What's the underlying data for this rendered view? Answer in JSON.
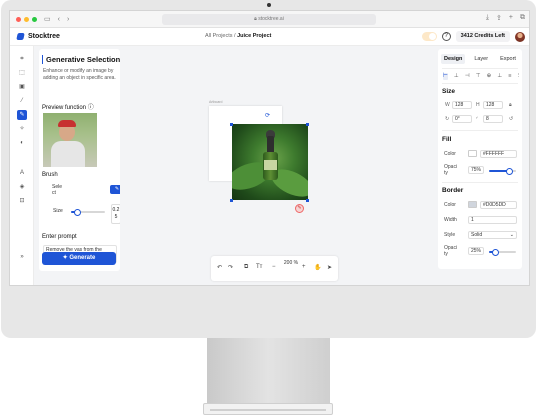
{
  "browser": {
    "url": "stocktree.ai"
  },
  "header": {
    "brand": "Stocktree",
    "breadcrumb_parent": "All Projects",
    "breadcrumb_sep": "/",
    "breadcrumb_current": "Juice Project",
    "help_glyph": "?",
    "credits": "3412 Credits Left"
  },
  "rail": {
    "tools": [
      "crop-icon",
      "select-icon",
      "image-icon",
      "wand-icon",
      "generative-selection-icon",
      "magic-edit-icon",
      "color-icon",
      "text-icon",
      "layers-icon",
      "upscale-icon"
    ],
    "expand": "»"
  },
  "left_panel": {
    "title": "Generative Selection",
    "description": "Enhance or modify an image by adding an object in specific area.",
    "preview_label": "Preview function",
    "brush_label": "Brush",
    "brush_select_label": "Select",
    "size_label": "Size",
    "size_value": "0.25",
    "size_fraction": 0.2,
    "prompt_label": "Enter prompt",
    "prompt_value": "Remove the vas from the image keeping the subject",
    "generate_label": "Generate"
  },
  "canvas": {
    "artboard_label": "Artboard",
    "zoom": "200 %"
  },
  "bottom_toolbar": {
    "undo": "↶",
    "redo": "↷",
    "duplicate": "⧉",
    "text": "Tт",
    "zoom_out": "−",
    "zoom_in": "+",
    "hand": "✋",
    "pointer": "➤"
  },
  "right_panel": {
    "tabs": [
      "Design",
      "Layer",
      "Export"
    ],
    "active_tab": "Design",
    "size_title": "Size",
    "w_label": "W",
    "w_value": "128",
    "h_label": "H",
    "h_value": "128",
    "rotation_value": "0°",
    "radius_value": "8",
    "fill_title": "Fill",
    "fill_color_label": "Color",
    "fill_color_value": "#FFFFFF",
    "fill_opacity_label": "Opacity",
    "fill_opacity_value": "75%",
    "fill_opacity_fraction": 0.75,
    "border_title": "Border",
    "border_color_label": "Color",
    "border_color_value": "#D0D5DD",
    "border_width_label": "Width",
    "border_width_value": "1",
    "border_style_label": "Style",
    "border_style_value": "Solid",
    "border_opacity_label": "Opacity",
    "border_opacity_value": "25%",
    "border_opacity_fraction": 0.25
  },
  "colors": {
    "accent": "#1f55d6",
    "fill_swatch": "#FFFFFF",
    "border_swatch": "#D0D5DD"
  }
}
